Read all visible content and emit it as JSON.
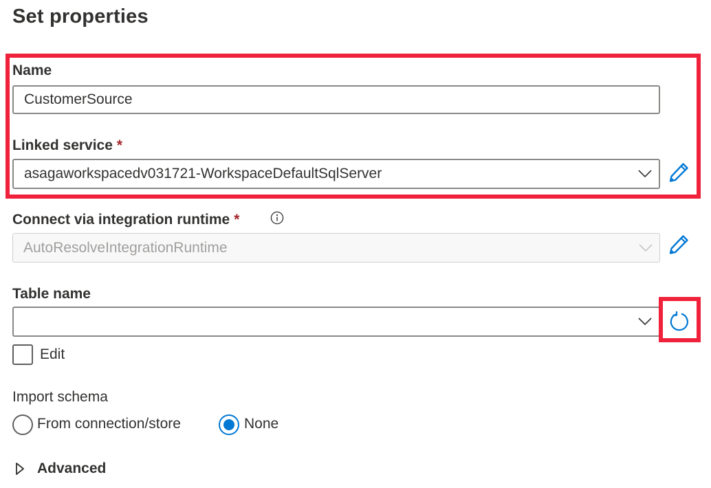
{
  "page": {
    "title": "Set properties"
  },
  "name_field": {
    "label": "Name",
    "value": "CustomerSource"
  },
  "linked_service": {
    "label": "Linked service",
    "required_marker": "*",
    "value": "asagaworkspacedv031721-WorkspaceDefaultSqlServer",
    "edit_icon": "pencil-icon"
  },
  "integration_runtime": {
    "label": "Connect via integration runtime",
    "required_marker": "*",
    "info_icon": "info-icon",
    "value": "AutoResolveIntegrationRuntime",
    "disabled": true,
    "edit_icon": "pencil-icon"
  },
  "table_name": {
    "label": "Table name",
    "value": "",
    "refresh_icon": "refresh-icon",
    "edit_checkbox": {
      "label": "Edit",
      "checked": false
    }
  },
  "import_schema": {
    "label": "Import schema",
    "options": [
      {
        "label": "From connection/store",
        "selected": false
      },
      {
        "label": "None",
        "selected": true
      }
    ]
  },
  "advanced": {
    "label": "Advanced",
    "expanded": false
  },
  "colors": {
    "highlight": "#f0213a",
    "accent": "#0078d4",
    "required": "#a4262c"
  }
}
